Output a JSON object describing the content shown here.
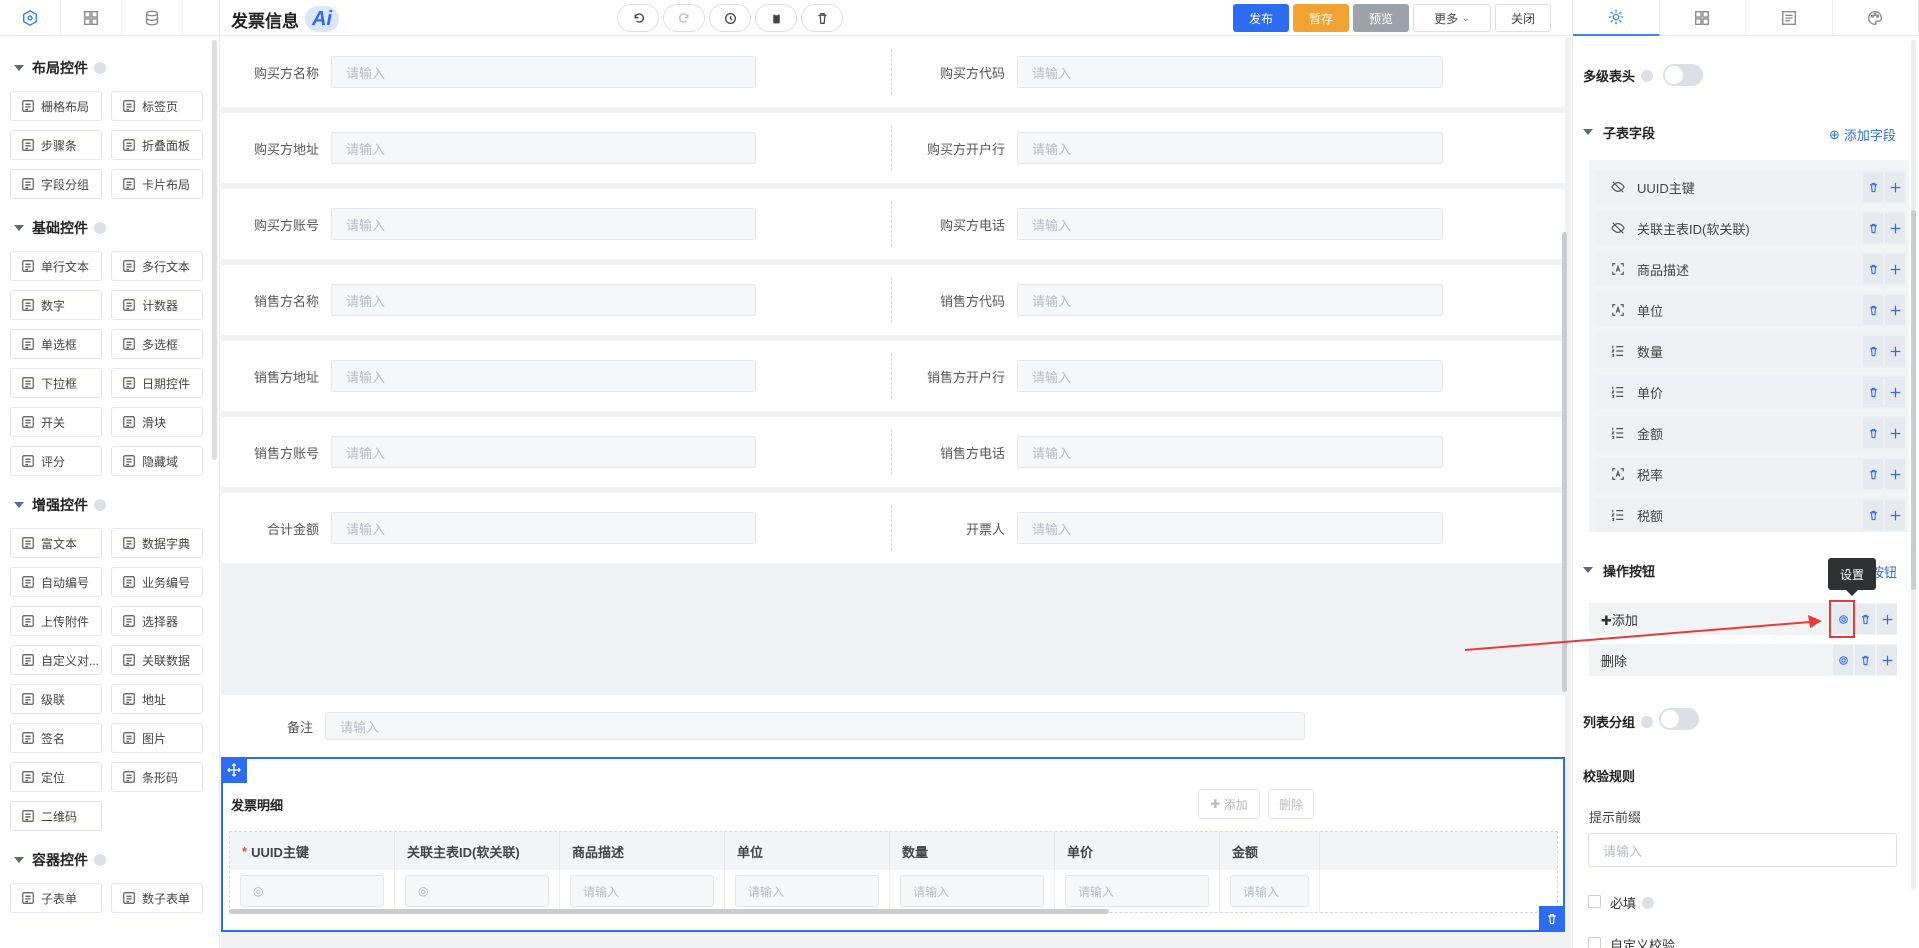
{
  "header": {
    "title": "发票信息",
    "ai_label": "Ai",
    "publish": "发布",
    "save_draft": "暂存",
    "preview": "预览",
    "more": "更多",
    "close": "关闭"
  },
  "left_panel": {
    "groups": [
      {
        "title": "布局控件",
        "items": [
          "栅格布局",
          "标签页",
          "步骤条",
          "折叠面板",
          "字段分组",
          "卡片布局"
        ]
      },
      {
        "title": "基础控件",
        "items": [
          "单行文本",
          "多行文本",
          "数字",
          "计数器",
          "单选框",
          "多选框",
          "下拉框",
          "日期控件",
          "开关",
          "滑块",
          "评分",
          "隐藏域"
        ]
      },
      {
        "title": "增强控件",
        "items": [
          "富文本",
          "数据字典",
          "自动编号",
          "业务编号",
          "上传附件",
          "选择器",
          "自定义对...",
          "关联数据",
          "级联",
          "地址",
          "签名",
          "图片",
          "定位",
          "条形码",
          "二维码"
        ]
      },
      {
        "title": "容器控件",
        "items": [
          "子表单",
          "数子表单"
        ]
      }
    ]
  },
  "form": {
    "placeholder": "请输入",
    "rows": [
      {
        "left": "购买方名称",
        "right": "购买方代码"
      },
      {
        "left": "购买方地址",
        "right": "购买方开户行"
      },
      {
        "left": "购买方账号",
        "right": "购买方电话"
      },
      {
        "left": "销售方名称",
        "right": "销售方代码"
      },
      {
        "left": "销售方地址",
        "right": "销售方开户行"
      },
      {
        "left": "销售方账号",
        "right": "销售方电话"
      },
      {
        "left": "合计金额",
        "right": "开票人"
      }
    ],
    "remark_label": "备注"
  },
  "detail": {
    "title": "发票明细",
    "add_label": "添加",
    "delete_label": "删除",
    "columns": [
      "UUID主键",
      "关联主表ID(软关联)",
      "商品描述",
      "单位",
      "数量",
      "单价",
      "金额"
    ],
    "cell_placeholder": "请输入"
  },
  "right_panel": {
    "multi_header": "多级表头",
    "subfields_title": "子表字段",
    "add_field": "添加字段",
    "fields": [
      {
        "name": "UUID主键",
        "icon": "eye-off-icon"
      },
      {
        "name": "关联主表ID(软关联)",
        "icon": "eye-off-icon"
      },
      {
        "name": "商品描述",
        "icon": "text-input-icon"
      },
      {
        "name": "单位",
        "icon": "text-input-icon"
      },
      {
        "name": "数量",
        "icon": "number-list-icon"
      },
      {
        "name": "单价",
        "icon": "number-list-icon"
      },
      {
        "name": "金额",
        "icon": "number-list-icon"
      },
      {
        "name": "税率",
        "icon": "text-input-icon"
      },
      {
        "name": "税额",
        "icon": "number-list-icon"
      }
    ],
    "op_buttons_title": "操作按钮",
    "add_button_partial": "加按钮",
    "tooltip": "设置",
    "buttons": [
      "✚添加",
      "删除"
    ],
    "list_group": "列表分组",
    "validation_title": "校验规则",
    "prompt_prefix": "提示前缀",
    "prompt_placeholder": "请输入",
    "required": "必填",
    "custom_validation": "自定义校验"
  },
  "colors": {
    "primary": "#2d6cf0",
    "warning": "#f0a233",
    "gray_button": "#9ea3ab",
    "highlight_red": "#e63b3b"
  }
}
